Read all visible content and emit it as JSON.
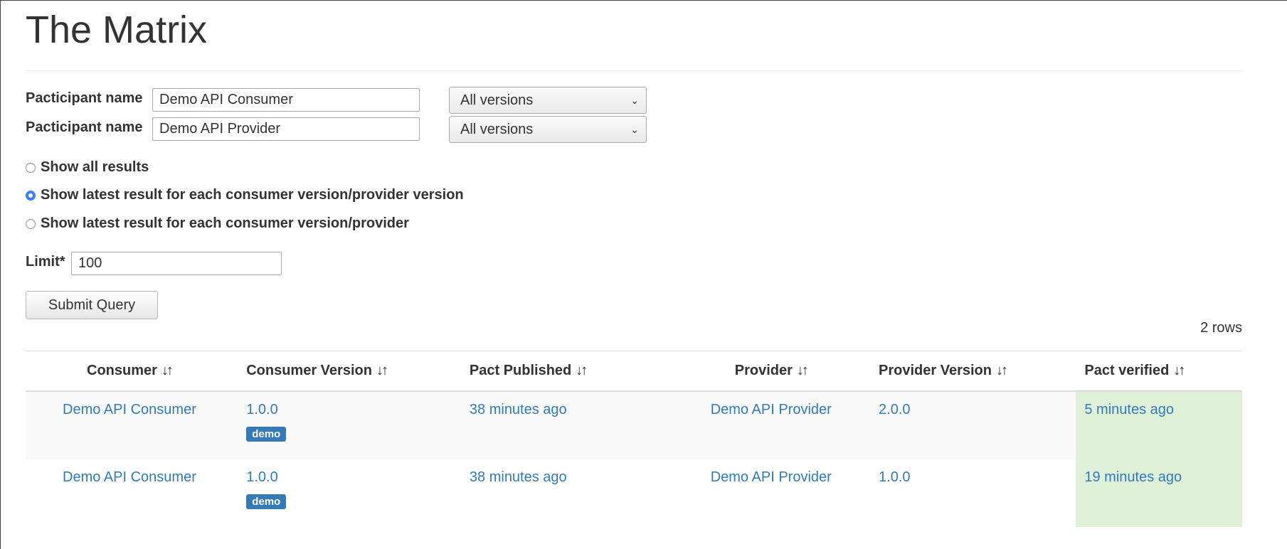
{
  "page": {
    "title": "The Matrix"
  },
  "form": {
    "participant1": {
      "label": "Pacticipant name",
      "value": "Demo API Consumer",
      "version": "All versions"
    },
    "participant2": {
      "label": "Pacticipant name",
      "value": "Demo API Provider",
      "version": "All versions"
    },
    "radios": [
      {
        "label": "Show all results",
        "checked": false
      },
      {
        "label": "Show latest result for each consumer version/provider version",
        "checked": true
      },
      {
        "label": "Show latest result for each consumer version/provider",
        "checked": false
      }
    ],
    "limit": {
      "label": "Limit*",
      "value": "100"
    },
    "submit_label": "Submit Query"
  },
  "results": {
    "row_count": "2 rows",
    "sort_icon": "sort-arrows-icon",
    "sort_glyph": "↓↑",
    "columns": [
      "Consumer",
      "Consumer Version",
      "Pact Published",
      "Provider",
      "Provider Version",
      "Pact verified"
    ],
    "rows": [
      {
        "consumer": "Demo API Consumer",
        "consumer_version": "1.0.0",
        "tag": "demo",
        "pact_published": "38 minutes ago",
        "provider": "Demo API Provider",
        "provider_version": "2.0.0",
        "verified": "5 minutes ago"
      },
      {
        "consumer": "Demo API Consumer",
        "consumer_version": "1.0.0",
        "tag": "demo",
        "pact_published": "38 minutes ago",
        "provider": "Demo API Provider",
        "provider_version": "1.0.0",
        "verified": "19 minutes ago"
      }
    ],
    "colors": {
      "link": "#337ab7",
      "verified_bg": "#dff0d8",
      "badge": "#337ab7"
    }
  }
}
